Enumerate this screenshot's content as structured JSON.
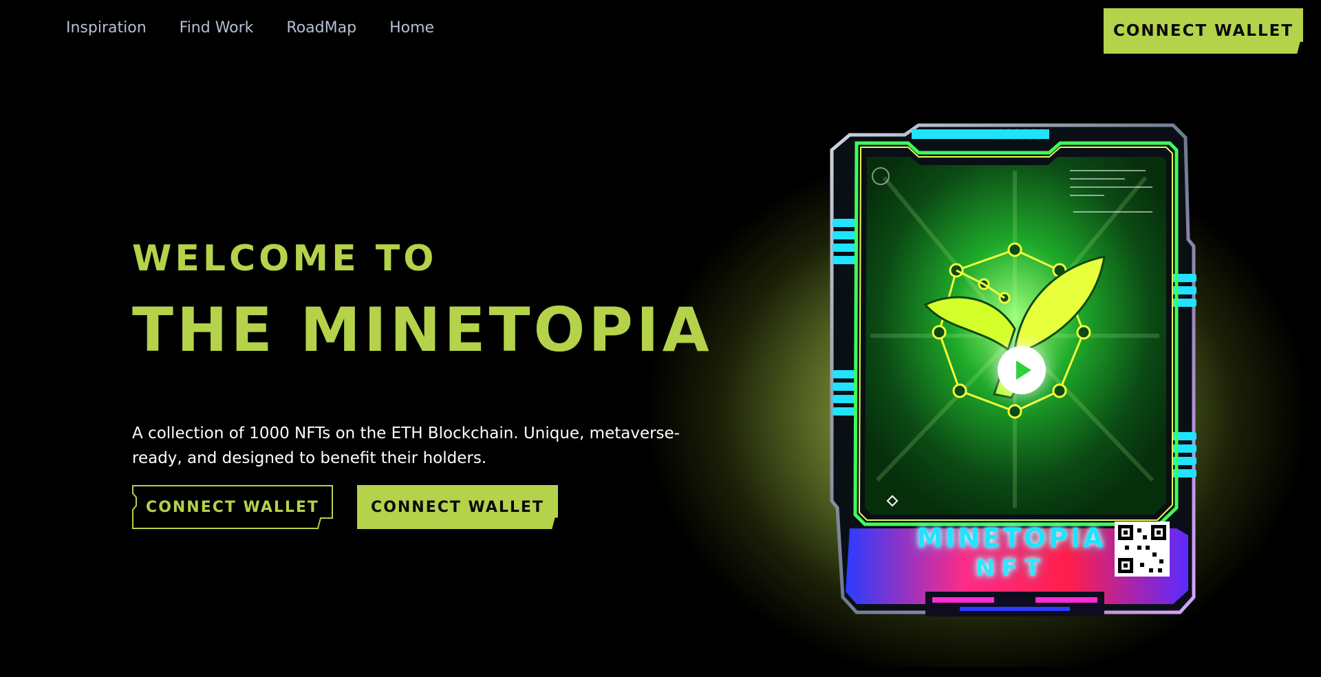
{
  "nav": {
    "links": [
      {
        "label": "Inspiration"
      },
      {
        "label": "Find Work"
      },
      {
        "label": "RoadMap"
      },
      {
        "label": "Home"
      }
    ],
    "connect_label": "Connect Wallet"
  },
  "hero": {
    "subtitle": "Welcome to",
    "title": "The Minetopia",
    "description": "A collection of 1000 NFTs on the ETH Blockchain. Unique, metaverse-ready, and designed to benefit their holders.",
    "primary_button": "Connect Wallet",
    "secondary_button": "Connect Wallet"
  },
  "card": {
    "title": "MINETOPIA",
    "subtitle": "NFT"
  },
  "colors": {
    "accent": "#b5d24b",
    "background": "#000000",
    "nav_text": "#b6bfd6",
    "card_cyan": "#1fe3ff",
    "card_green": "#2fd23b",
    "card_magenta": "#ff2bd6"
  },
  "icons": {
    "play": "play-icon",
    "qr": "qr-code-icon",
    "leaf": "leaf-logo-icon"
  }
}
